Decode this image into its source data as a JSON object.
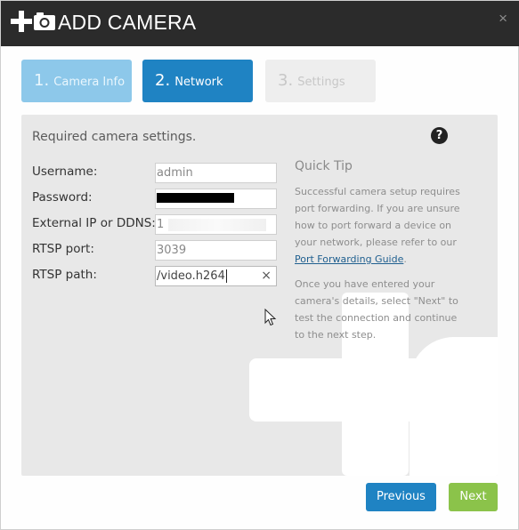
{
  "header": {
    "title": "ADD CAMERA",
    "close_glyph": "×",
    "icons": [
      "plus-icon",
      "camera-icon",
      "close-icon"
    ]
  },
  "steps": [
    {
      "number": "1.",
      "label": "Camera Info",
      "state": "completed"
    },
    {
      "number": "2.",
      "label": "Network",
      "state": "active"
    },
    {
      "number": "3.",
      "label": "Settings",
      "state": "pending"
    }
  ],
  "form": {
    "section_title": "Required camera settings.",
    "help_glyph": "?",
    "fields": {
      "username": {
        "label": "Username:",
        "value": "admin"
      },
      "password": {
        "label": "Password:",
        "value": ""
      },
      "external_ip": {
        "label": "External IP or DDNS:",
        "value": "1"
      },
      "rtsp_port": {
        "label": "RTSP port:",
        "value": "3039"
      },
      "rtsp_path": {
        "label": "RTSP path:",
        "value": "/video.h264",
        "clear_glyph": "×"
      }
    }
  },
  "quick_tip": {
    "title": "Quick Tip",
    "para1_text": "Successful camera setup requires port forwarding. If you are unsure how to port forward a device on your network, please refer to our ",
    "link_text": "Port Forwarding Guide",
    "para1_end": ".",
    "para2": "Once you have entered your camera's details, select \"Next\" to test the connection and continue to the next step."
  },
  "footer": {
    "previous_label": "Previous",
    "next_label": "Next"
  },
  "colors": {
    "header_bg": "#2b2b2b",
    "step_completed": "#8dc8ea",
    "step_active": "#1f83c3",
    "step_pending": "#eeeeee",
    "panel_bg": "#e8e8e8",
    "primary_button": "#1f83c3",
    "next_button": "#8bc34a",
    "link": "#1f5f8f"
  }
}
